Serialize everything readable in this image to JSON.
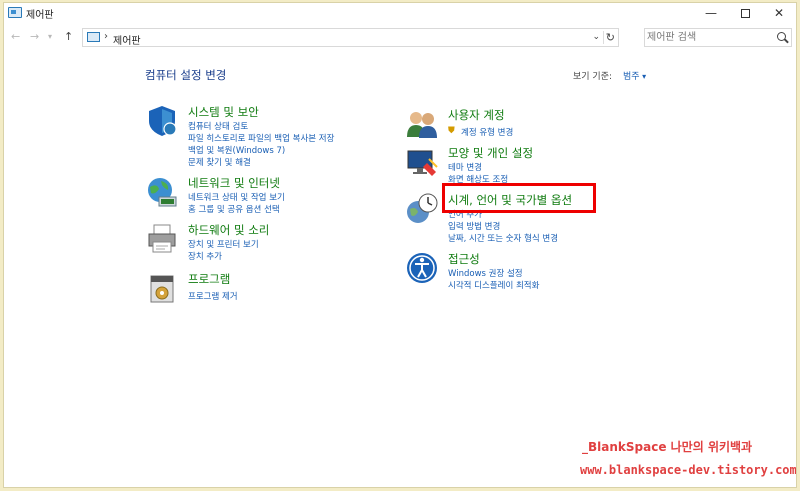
{
  "window": {
    "title": "제어판"
  },
  "address": {
    "path": "제어판",
    "search_placeholder": "제어판 검색"
  },
  "heading": "컴퓨터 설정 변경",
  "view_by": {
    "label": "보기 기준:",
    "value": "범주"
  },
  "categories": [
    {
      "title": "시스템 및 보안",
      "icon": "shield-icon",
      "links": [
        "컴퓨터 상태 검토",
        "파일 히스토리로 파일의 백업 복사본 저장",
        "백업 및 복원(Windows 7)",
        "문제 찾기 및 해결"
      ]
    },
    {
      "title": "네트워크 및 인터넷",
      "icon": "network-globe-icon",
      "links": [
        "네트워크 상태 및 작업 보기",
        "홈 그룹 및 공유 옵션 선택"
      ]
    },
    {
      "title": "하드웨어 및 소리",
      "icon": "printer-icon",
      "links": [
        "장치 및 프린터 보기",
        "장치 추가"
      ]
    },
    {
      "title": "프로그램",
      "icon": "programs-icon",
      "links": [
        "프로그램 제거"
      ]
    },
    {
      "title": "사용자 계정",
      "icon": "users-icon",
      "links": [
        "계정 유형 변경"
      ]
    },
    {
      "title": "모양 및 개인 설정",
      "icon": "appearance-icon",
      "links": [
        "테마 변경",
        "화면 해상도 조정"
      ]
    },
    {
      "title": "시계, 언어 및 국가별 옵션",
      "icon": "clock-globe-icon",
      "links": [
        "언어 추가",
        "입력 방법 변경",
        "날짜, 시간 또는 숫자 형식 변경"
      ]
    },
    {
      "title": "접근성",
      "icon": "accessibility-icon",
      "links": [
        "Windows 권장 설정",
        "시각적 디스플레이 최적화"
      ]
    }
  ],
  "watermark": {
    "line1": "_BlankSpace 나만의 위키백과",
    "line2": "www.blankspace-dev.tistory.com"
  },
  "colors": {
    "category_title": "#0f7b0f",
    "link": "#1a5fb4",
    "highlight": "#ee0000"
  }
}
